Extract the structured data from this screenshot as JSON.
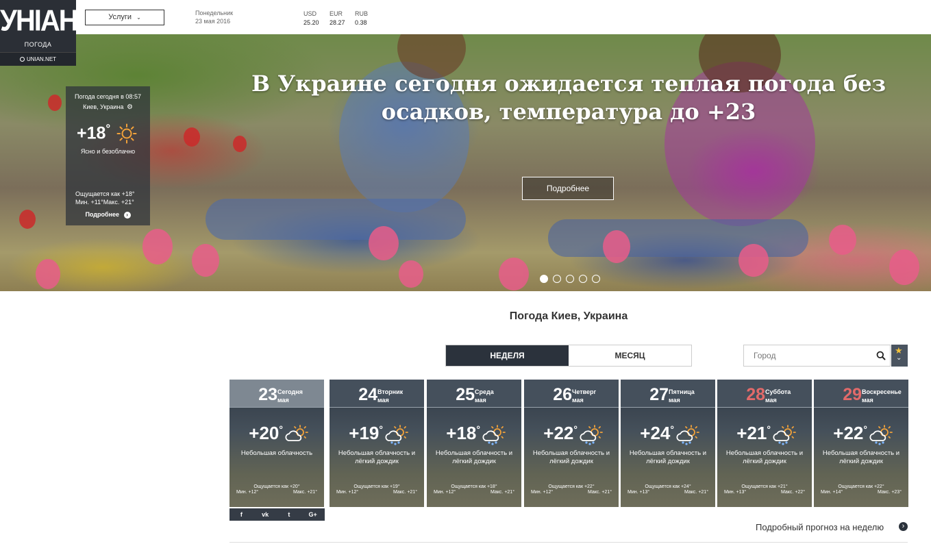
{
  "header": {
    "logo": "УНІАН",
    "logo_sub": "ПОГОДА",
    "logo_link": "UNIAN.NET",
    "services_label": "Услуги",
    "weekday": "Понедельник",
    "date": "23 мая 2016",
    "currencies": [
      {
        "code": "USD",
        "value": "25.20"
      },
      {
        "code": "EUR",
        "value": "28.27"
      },
      {
        "code": "RUB",
        "value": "0.38"
      }
    ]
  },
  "hero": {
    "title": "В Украине сегодня ожидается теплая погода без осадков, температура до +23",
    "more_label": "Подробнее",
    "slides_total": 5,
    "active_slide": 1
  },
  "widget": {
    "title": "Погода сегодня в 08:57",
    "city": "Киев, Украина",
    "temp": "+18",
    "deg": "°",
    "desc": "Ясно и безоблачно",
    "feels": "Ощущается как  +18°",
    "minmax": "Мин.  +11°Макс.  +21°",
    "more_label": "Подробнее"
  },
  "forecast": {
    "title": "Погода Киев, Украина",
    "tabs": [
      {
        "label": "НЕДЕЛЯ",
        "active": true
      },
      {
        "label": "МЕСЯЦ",
        "active": false
      }
    ],
    "search_placeholder": "Город",
    "days": [
      {
        "num": "23",
        "name": "Сегодня",
        "month": "мая",
        "temp": "+20",
        "desc": "Небольшая облачность",
        "feels": "Ощущается как +20°",
        "min": "Мин. +12°",
        "max": "Макс. +21°",
        "weekend": false,
        "rain": false
      },
      {
        "num": "24",
        "name": "Вторник",
        "month": "мая",
        "temp": "+19",
        "desc": "Небольшая облачность и лёгкий дождик",
        "feels": "Ощущается как +19°",
        "min": "Мин. +12°",
        "max": "Макс. +21°",
        "weekend": false,
        "rain": true
      },
      {
        "num": "25",
        "name": "Среда",
        "month": "мая",
        "temp": "+18",
        "desc": "Небольшая облачность и лёгкий дождик",
        "feels": "Ощущается как +18°",
        "min": "Мин. +12°",
        "max": "Макс. +21°",
        "weekend": false,
        "rain": true
      },
      {
        "num": "26",
        "name": "Четверг",
        "month": "мая",
        "temp": "+22",
        "desc": "Небольшая облачность и лёгкий дождик",
        "feels": "Ощущается как +22°",
        "min": "Мин. +12°",
        "max": "Макс. +21°",
        "weekend": false,
        "rain": true
      },
      {
        "num": "27",
        "name": "Пятница",
        "month": "мая",
        "temp": "+24",
        "desc": "Небольшая облачность и лёгкий дождик",
        "feels": "Ощущается как +24°",
        "min": "Мин. +13°",
        "max": "Макс. +21°",
        "weekend": false,
        "rain": true
      },
      {
        "num": "28",
        "name": "Суббота",
        "month": "мая",
        "temp": "+21",
        "desc": "Небольшая облачность и лёгкий дождик",
        "feels": "Ощущается как +21°",
        "min": "Мин. +13°",
        "max": "Макс. +22°",
        "weekend": true,
        "rain": true
      },
      {
        "num": "29",
        "name": "Воскресенье",
        "month": "мая",
        "temp": "+22",
        "desc": "Небольшая облачность и лёгкий дождик",
        "feels": "Ощущается как +22°",
        "min": "Мин. +14°",
        "max": "Макс. +23°",
        "weekend": true,
        "rain": true
      }
    ],
    "social": [
      "f",
      "vk",
      "t",
      "G+"
    ],
    "week_more_label": "Подробный прогноз на неделю"
  },
  "colors": {
    "dark": "#2b323c",
    "weekend_red": "#e26a6a",
    "sun": "#f2a23a",
    "rain": "#7fb7ff"
  },
  "icons": {
    "widget_weather": "sun-icon",
    "day_weather": "partly-cloudy-icon",
    "day_weather_rain": "cloud-rain-icon",
    "search": "search-icon",
    "favorite": "star-icon",
    "expand": "chevron-down-icon",
    "settings": "gear-icon",
    "more": "chevron-right-circle-icon"
  }
}
